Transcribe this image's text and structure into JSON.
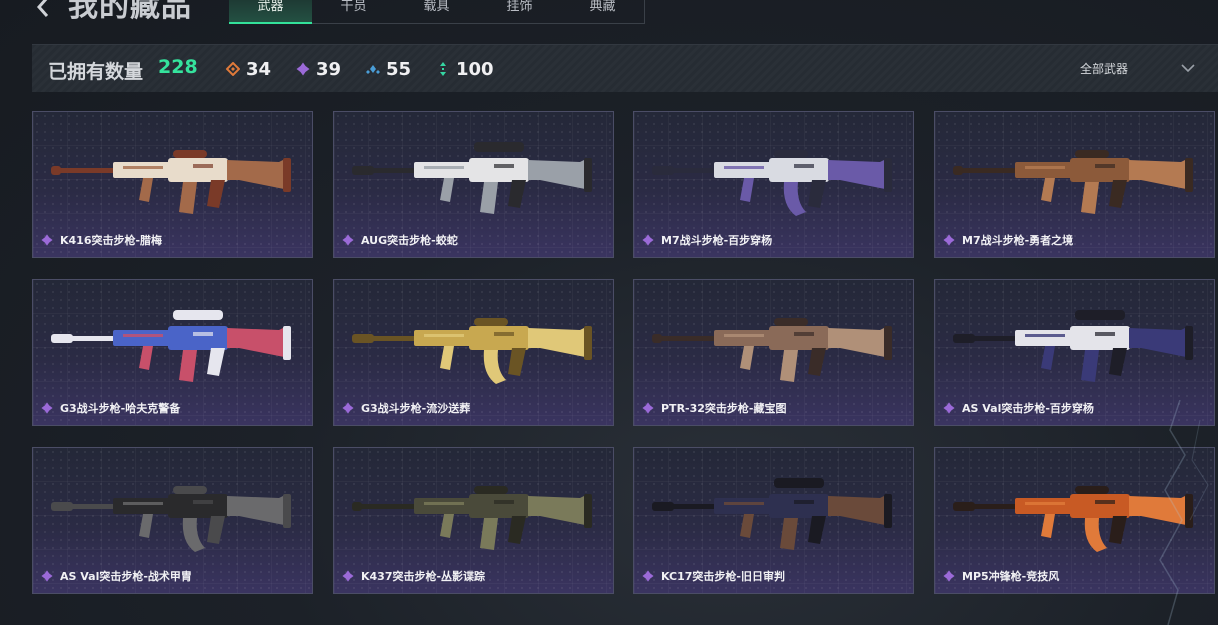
{
  "header": {
    "title": "我的藏品",
    "tabs": [
      {
        "label": "武器",
        "active": true
      },
      {
        "label": "干员",
        "active": false
      },
      {
        "label": "载具",
        "active": false
      },
      {
        "label": "挂饰",
        "active": false
      },
      {
        "label": "典藏",
        "active": false
      }
    ]
  },
  "stats": {
    "owned_label": "已拥有数量",
    "owned_count": "228",
    "rarities": [
      {
        "icon": "orange-diamond-icon",
        "color": "#e07a3a",
        "count": "34"
      },
      {
        "icon": "purple-gem-icon",
        "color": "#9b6ad8",
        "count": "39"
      },
      {
        "icon": "blue-gem-icon",
        "color": "#4a9ed8",
        "count": "55"
      },
      {
        "icon": "green-arrow-icon",
        "color": "#35d6a2",
        "count": "100"
      }
    ],
    "filter": "全部武器"
  },
  "weapons": [
    {
      "name": "K416突击步枪-腊梅",
      "rarity": "purple",
      "palette": [
        "#e8dccb",
        "#7a3a28",
        "#a36a4a"
      ]
    },
    {
      "name": "AUG突击步枪-蛟蛇",
      "rarity": "purple",
      "palette": [
        "#e4e4e6",
        "#2a2a2e",
        "#9aa0a8"
      ]
    },
    {
      "name": "M7战斗步枪-百步穿杨",
      "rarity": "purple",
      "palette": [
        "#d9dbe2",
        "#2a2b3c",
        "#6a5aa8"
      ]
    },
    {
      "name": "M7战斗步枪-勇者之境",
      "rarity": "purple",
      "palette": [
        "#8c5a3a",
        "#3a2a22",
        "#b47a52"
      ]
    },
    {
      "name": "G3战斗步枪-哈夫克警备",
      "rarity": "purple",
      "palette": [
        "#4a64c8",
        "#e6e6ee",
        "#c8506a"
      ]
    },
    {
      "name": "G3战斗步枪-流沙送葬",
      "rarity": "purple",
      "palette": [
        "#c8a850",
        "#6a5424",
        "#e0c878"
      ]
    },
    {
      "name": "PTR-32突击步枪-藏宝图",
      "rarity": "purple",
      "palette": [
        "#8a6a58",
        "#3a2c28",
        "#b09078"
      ]
    },
    {
      "name": "AS Val突击步枪-百步穿杨",
      "rarity": "purple",
      "palette": [
        "#e4e4ea",
        "#1e1e28",
        "#3a3a78"
      ]
    },
    {
      "name": "AS Val突击步枪-战术甲胄",
      "rarity": "purple",
      "palette": [
        "#2a2a2c",
        "#4a4a4c",
        "#6a6a6c"
      ]
    },
    {
      "name": "K437突击步枪-丛影谍踪",
      "rarity": "purple",
      "palette": [
        "#4a4a3a",
        "#2a2a22",
        "#7a7a5a"
      ]
    },
    {
      "name": "KC17突击步枪-旧日审判",
      "rarity": "purple",
      "palette": [
        "#2e3050",
        "#1a1a22",
        "#6a4a3a"
      ]
    },
    {
      "name": "MP5冲锋枪-竞技风",
      "rarity": "purple",
      "palette": [
        "#c85a24",
        "#2a1e1a",
        "#e07a3a"
      ]
    }
  ]
}
